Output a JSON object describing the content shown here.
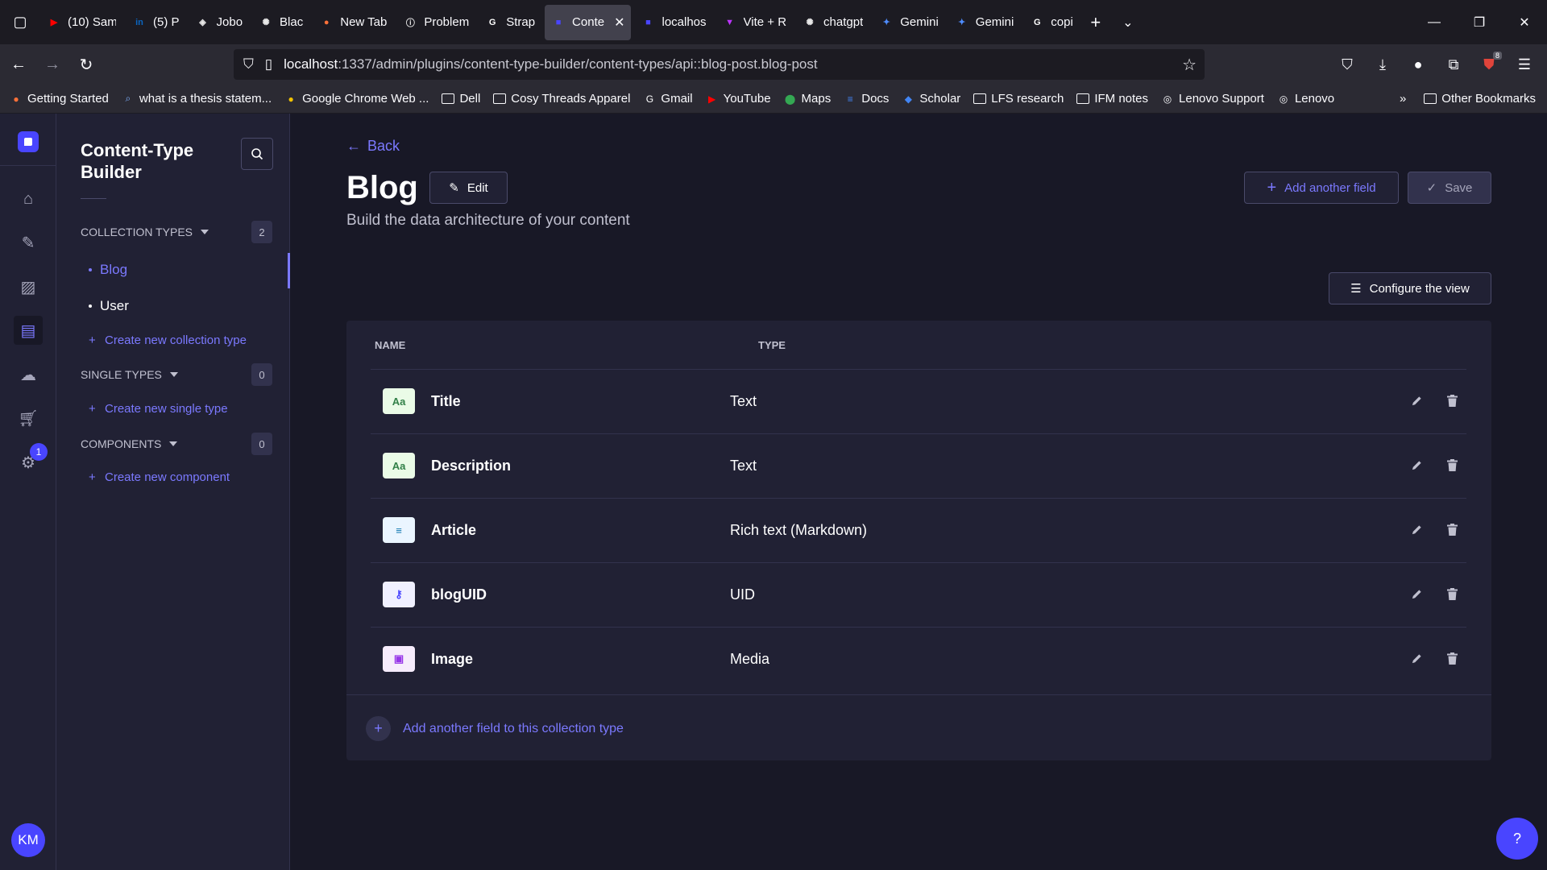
{
  "browser": {
    "tabs": [
      {
        "title": "(10) Sam",
        "icon": "youtube-icon",
        "color": "#ff0000",
        "glyph": "▶"
      },
      {
        "title": "(5) P",
        "icon": "linkedin-icon",
        "color": "#0a66c2",
        "glyph": "in"
      },
      {
        "title": "Jobo",
        "icon": "cube-icon",
        "color": "#e8e8e8",
        "glyph": "◈"
      },
      {
        "title": "Blac",
        "icon": "openai-icon",
        "color": "#e8e8e8",
        "glyph": "✺"
      },
      {
        "title": "New Tab",
        "icon": "firefox-icon",
        "color": "#ff7139",
        "glyph": "●"
      },
      {
        "title": "Problem",
        "icon": "info-icon",
        "color": "#e8e8e8",
        "glyph": "ⓘ"
      },
      {
        "title": "Strap",
        "icon": "google-icon",
        "color": "#ffffff",
        "glyph": "G"
      },
      {
        "title": "Conte",
        "icon": "strapi-icon",
        "color": "#4945ff",
        "glyph": "■",
        "active": true
      },
      {
        "title": "localhos",
        "icon": "strapi-icon",
        "color": "#4945ff",
        "glyph": "■"
      },
      {
        "title": "Vite + R",
        "icon": "vite-icon",
        "color": "#bd34fe",
        "glyph": "▼"
      },
      {
        "title": "chatgpt",
        "icon": "openai-icon",
        "color": "#e8e8e8",
        "glyph": "✺"
      },
      {
        "title": "Gemini",
        "icon": "gemini-icon",
        "color": "#4e8cff",
        "glyph": "✦"
      },
      {
        "title": "Gemini",
        "icon": "gemini-icon",
        "color": "#4e8cff",
        "glyph": "✦"
      },
      {
        "title": "copi",
        "icon": "google-icon",
        "color": "#ffffff",
        "glyph": "G"
      }
    ],
    "url_host": "localhost",
    "url_path": ":1337/admin/plugins/content-type-builder/content-types/api::blog-post.blog-post",
    "extension_badge": "8",
    "bookmarks": [
      {
        "label": "Getting Started",
        "icon": "firefox-icon",
        "color": "#ff7139",
        "glyph": "●"
      },
      {
        "label": "what is a thesis statem...",
        "icon": "search-icon",
        "color": "#7fb2ff",
        "glyph": "⌕"
      },
      {
        "label": "Google Chrome Web ...",
        "icon": "chrome-icon",
        "color": "#f2c200",
        "glyph": "●"
      },
      {
        "label": "Dell",
        "icon": "folder-icon",
        "folder": true
      },
      {
        "label": "Cosy Threads Apparel",
        "icon": "folder-icon",
        "folder": true
      },
      {
        "label": "Gmail",
        "icon": "google-icon",
        "color": "#ffffff",
        "glyph": "G"
      },
      {
        "label": "YouTube",
        "icon": "youtube-icon",
        "color": "#ff0000",
        "glyph": "▶"
      },
      {
        "label": "Maps",
        "icon": "maps-pin-icon",
        "color": "#34a853",
        "glyph": "⬤"
      },
      {
        "label": "Docs",
        "icon": "docs-icon",
        "color": "#4285f4",
        "glyph": "≡"
      },
      {
        "label": "Scholar",
        "icon": "scholar-icon",
        "color": "#4285f4",
        "glyph": "◆"
      },
      {
        "label": "LFS research",
        "icon": "folder-icon",
        "folder": true
      },
      {
        "label": "IFM notes",
        "icon": "folder-icon",
        "folder": true
      },
      {
        "label": "Lenovo Support",
        "icon": "globe-icon",
        "color": "#fbfbfe",
        "glyph": "◎"
      },
      {
        "label": "Lenovo",
        "icon": "globe-icon",
        "color": "#fbfbfe",
        "glyph": "◎"
      }
    ],
    "other_bookmarks": "Other Bookmarks"
  },
  "sidebar": {
    "title": "Content-Type Builder",
    "collection_types": {
      "label": "Collection types",
      "count": "2",
      "items": [
        "Blog",
        "User"
      ],
      "active": "Blog",
      "create": "Create new collection type"
    },
    "single_types": {
      "label": "Single types",
      "count": "0",
      "create": "Create new single type"
    },
    "components": {
      "label": "Components",
      "count": "0",
      "create": "Create new component"
    }
  },
  "mainnav": {
    "settings_badge": "1",
    "user_initials": "KM"
  },
  "header": {
    "back": "Back",
    "title": "Blog",
    "edit": "Edit",
    "subtitle": "Build the data architecture of your content",
    "add_field": "Add another field",
    "save": "Save",
    "configure": "Configure the view"
  },
  "table": {
    "headers": {
      "name": "Name",
      "type": "Type"
    },
    "rows": [
      {
        "name": "Title",
        "type": "Text",
        "icon": "text-field-icon",
        "glyph": "Aa",
        "bg": "#eafbe7",
        "fg": "#328048"
      },
      {
        "name": "Description",
        "type": "Text",
        "icon": "text-field-icon",
        "glyph": "Aa",
        "bg": "#eafbe7",
        "fg": "#328048"
      },
      {
        "name": "Article",
        "type": "Rich text (Markdown)",
        "icon": "rich-text-icon",
        "glyph": "≡",
        "bg": "#eaf5ff",
        "fg": "#0c75af"
      },
      {
        "name": "blogUID",
        "type": "UID",
        "icon": "key-icon",
        "glyph": "⚷",
        "bg": "#f0f0ff",
        "fg": "#4945ff"
      },
      {
        "name": "Image",
        "type": "Media",
        "icon": "media-icon",
        "glyph": "▣",
        "bg": "#f6ecfc",
        "fg": "#9736e8"
      }
    ],
    "footer_add": "Add another field to this collection type"
  }
}
